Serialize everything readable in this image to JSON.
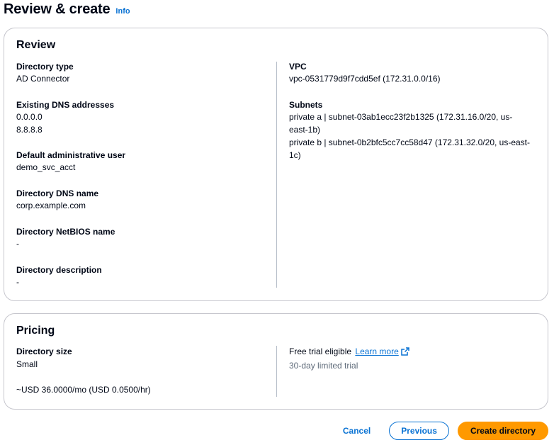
{
  "header": {
    "title": "Review & create",
    "info_label": "Info"
  },
  "review": {
    "title": "Review",
    "left": [
      {
        "label": "Directory type",
        "values": [
          "AD Connector"
        ]
      },
      {
        "label": "Existing DNS addresses",
        "values": [
          "0.0.0.0",
          "8.8.8.8"
        ]
      },
      {
        "label": "Default administrative user",
        "values": [
          "demo_svc_acct"
        ]
      },
      {
        "label": "Directory DNS name",
        "values": [
          "corp.example.com"
        ]
      },
      {
        "label": "Directory NetBIOS name",
        "values": [
          "-"
        ]
      },
      {
        "label": "Directory description",
        "values": [
          "-"
        ]
      }
    ],
    "right": [
      {
        "label": "VPC",
        "values": [
          "vpc-0531779d9f7cdd5ef (172.31.0.0/16)"
        ]
      },
      {
        "label": "Subnets",
        "values": [
          "private a | subnet-03ab1ecc23f2b1325 (172.31.16.0/20, us-east-1b)",
          "private b | subnet-0b2bfc5cc7cc58d47 (172.31.32.0/20, us-east-1c)"
        ]
      }
    ]
  },
  "pricing": {
    "title": "Pricing",
    "size_label": "Directory size",
    "size_value": "Small",
    "price": "~USD 36.0000/mo (USD 0.0500/hr)",
    "trial_label": "Free trial eligible",
    "learn_more": "Learn more",
    "trial_sub": "30-day limited trial"
  },
  "actions": {
    "cancel": "Cancel",
    "previous": "Previous",
    "create": "Create directory"
  },
  "colors": {
    "link": "#0972d3",
    "primary": "#ff9900",
    "border": "#c6c6cd",
    "text": "#000716"
  },
  "icons": {
    "external_link": "external-link-icon"
  }
}
